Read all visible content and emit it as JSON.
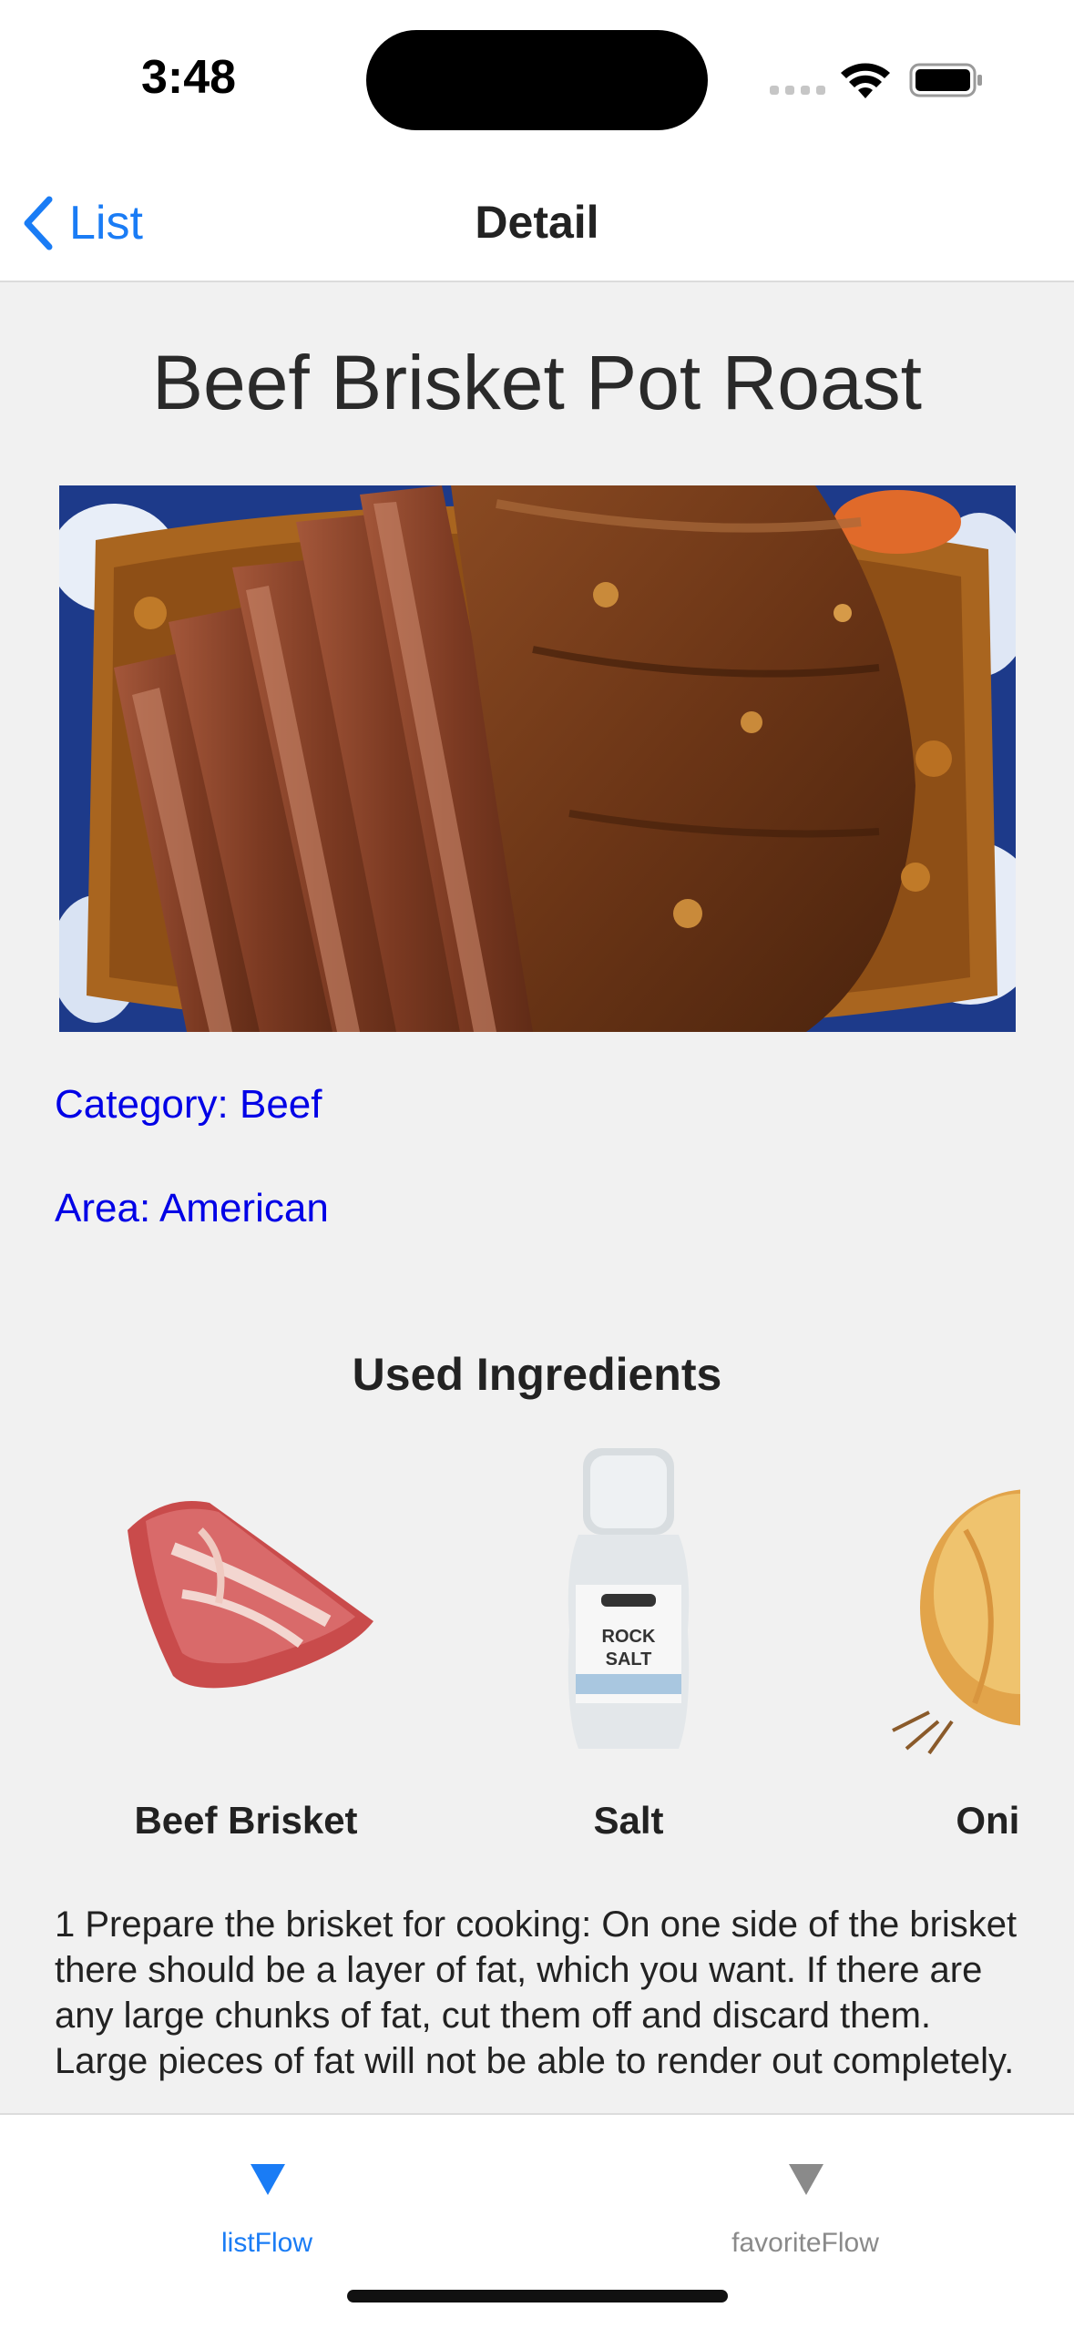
{
  "status_bar": {
    "time": "3:48",
    "wifi_icon": "wifi-icon",
    "battery_icon": "battery-icon"
  },
  "nav": {
    "back_label": "List",
    "back_icon": "chevron-left-icon",
    "title": "Detail"
  },
  "recipe": {
    "title": "Beef Brisket Pot Roast",
    "category_text": "Category: Beef",
    "area_text": "Area: American",
    "ingredients_title": "Used Ingredients",
    "ingredients": [
      {
        "name": "Beef Brisket",
        "icon": "beef-brisket-image"
      },
      {
        "name": "Salt",
        "icon": "salt-grinder-image"
      },
      {
        "name": "Onion",
        "icon": "onion-image"
      }
    ],
    "instructions": "1 Prepare the brisket for cooking: On one side of the brisket there should be a layer of fat, which you want. If there are any large chunks of fat, cut them off and discard them. Large pieces of fat will not be able to render out completely."
  },
  "tab_bar": {
    "tabs": [
      {
        "label": "listFlow",
        "icon": "triangle-down-icon",
        "selected": true
      },
      {
        "label": "favoriteFlow",
        "icon": "triangle-down-icon",
        "selected": false
      }
    ]
  },
  "colors": {
    "accent": "#1a7cf5",
    "link": "#0000e6",
    "background": "#f1f1f1"
  }
}
